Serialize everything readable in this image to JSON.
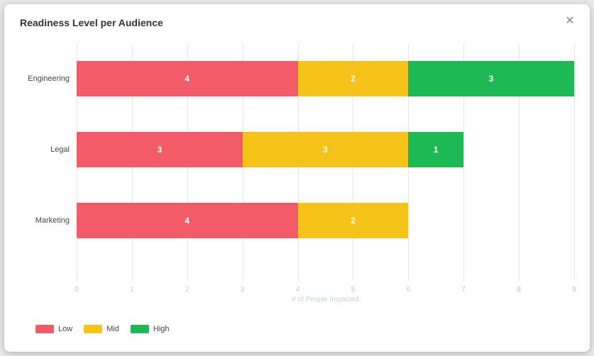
{
  "title": "Readiness Level per Audience",
  "close_glyph": "✕",
  "x_axis_label": "# of People Impacted",
  "x_ticks": [
    "0",
    "1",
    "2",
    "3",
    "4",
    "5",
    "6",
    "7",
    "8",
    "9"
  ],
  "colors": {
    "low": "#f45b69",
    "mid": "#f6c418",
    "high": "#1db954"
  },
  "legend": [
    {
      "key": "low",
      "label": "Low"
    },
    {
      "key": "mid",
      "label": "Mid"
    },
    {
      "key": "high",
      "label": "High"
    }
  ],
  "chart_data": {
    "type": "bar",
    "stacked": true,
    "orientation": "horizontal",
    "title": "Readiness Level per Audience",
    "xlabel": "# of People Impacted",
    "ylabel": "",
    "xlim": [
      0,
      9
    ],
    "categories": [
      "Engineering",
      "Legal",
      "Marketing"
    ],
    "series": [
      {
        "name": "Low",
        "color": "#f45b69",
        "values": [
          4,
          3,
          4
        ]
      },
      {
        "name": "Mid",
        "color": "#f6c418",
        "values": [
          2,
          3,
          2
        ]
      },
      {
        "name": "High",
        "color": "#1db954",
        "values": [
          3,
          1,
          0
        ]
      }
    ]
  }
}
